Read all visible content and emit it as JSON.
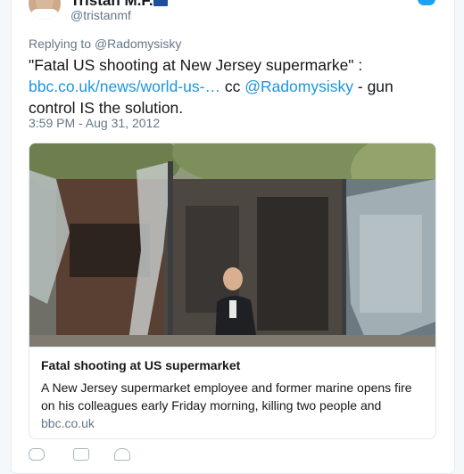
{
  "author": {
    "name": "Tristan M.F.",
    "handle": "@tristanmf"
  },
  "tweet": {
    "replying_prefix": "Replying to ",
    "replying_to": "@Radomysisky",
    "text_part1": "\"Fatal US shooting at New Jersey supermarke\" :",
    "link_url": "bbc.co.uk/news/world-us-…",
    "text_part2": " cc ",
    "mention": "@Radomysisky",
    "text_part3": " - gun control IS the solution.",
    "timestamp": "3:59 PM - Aug 31, 2012"
  },
  "card": {
    "title": "Fatal shooting at US supermarket",
    "description": "A New Jersey supermarket employee and former marine opens fire on his colleagues early Friday morning, killing two people and",
    "domain": "bbc.co.uk"
  },
  "colors": {
    "link": "#1b95e0",
    "muted": "#657786",
    "twitter_blue": "#1da1f2"
  },
  "icons": [
    "twitter-bird-icon",
    "flag-icon",
    "reply-icon",
    "retweet-icon",
    "like-icon"
  ]
}
